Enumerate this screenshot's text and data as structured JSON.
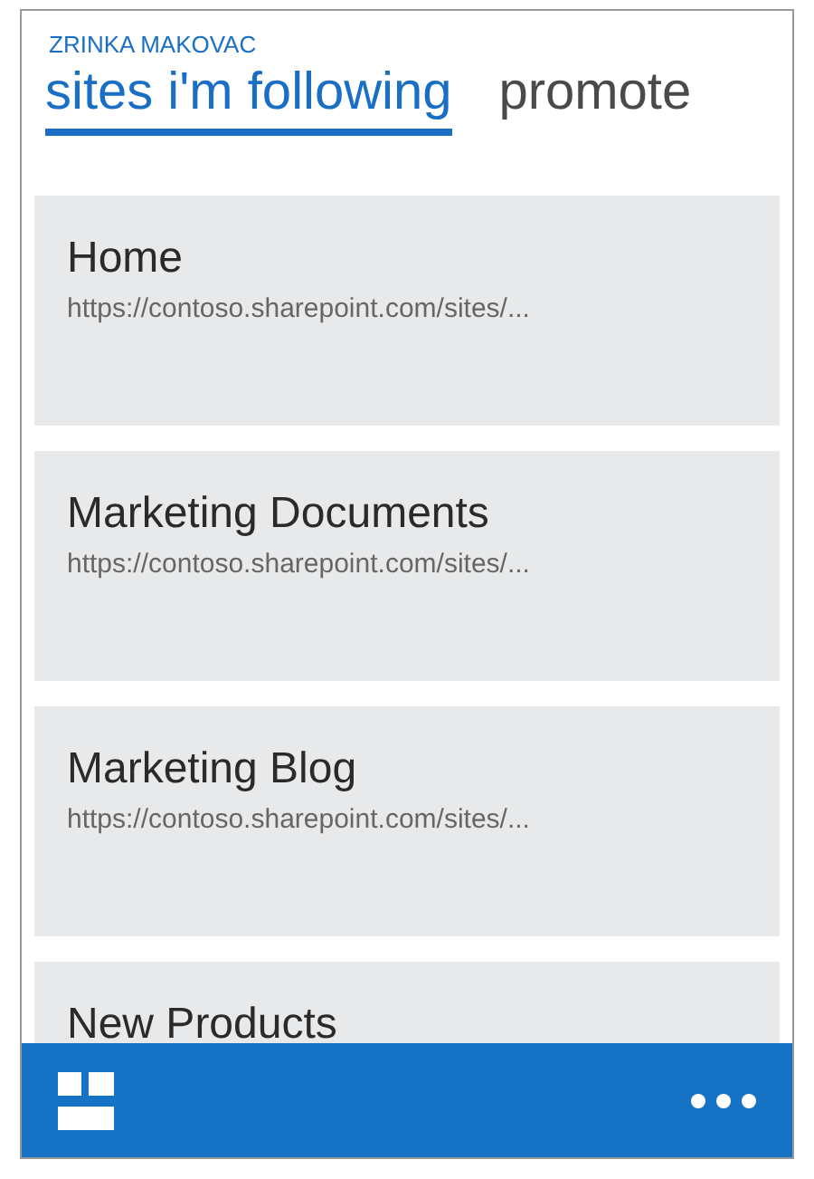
{
  "user_name": "ZRINKA MAKOVAC",
  "tabs": [
    {
      "label": "sites i'm following",
      "selected": true
    },
    {
      "label": "promote",
      "selected": false
    }
  ],
  "sites": [
    {
      "title": "Home",
      "url": "https://contoso.sharepoint.com/sites/..."
    },
    {
      "title": "Marketing Documents",
      "url": "https://contoso.sharepoint.com/sites/..."
    },
    {
      "title": "Marketing Blog",
      "url": "https://contoso.sharepoint.com/sites/..."
    },
    {
      "title": "New Products"
    }
  ]
}
